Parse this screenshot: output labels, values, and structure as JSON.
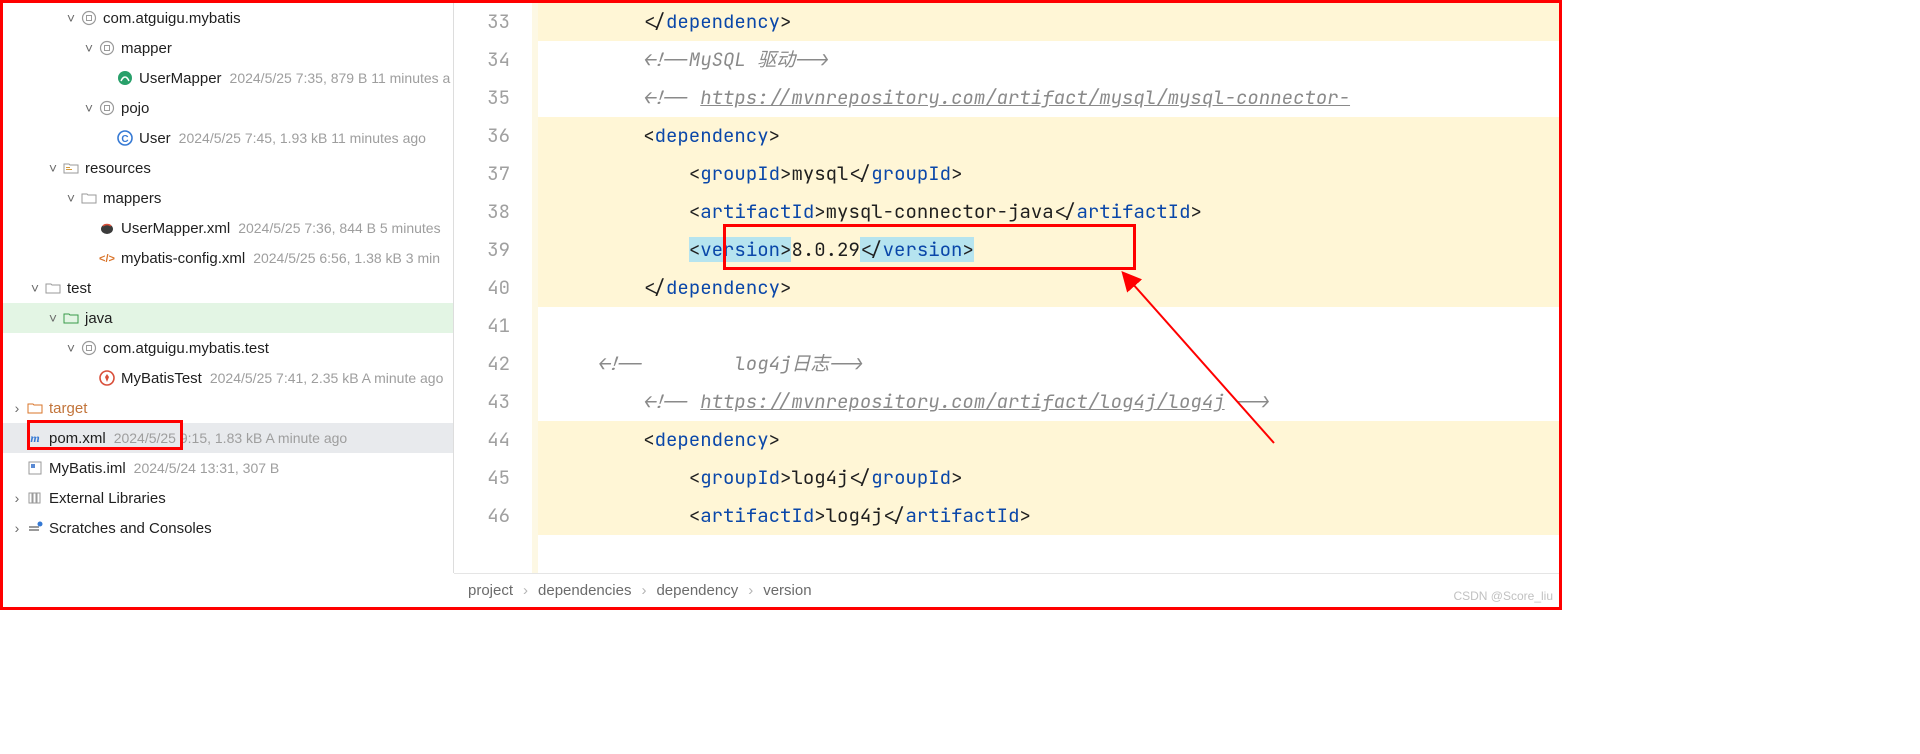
{
  "tree": {
    "n0": {
      "label": "com.atguigu.mybatis"
    },
    "n1": {
      "label": "mapper"
    },
    "n2": {
      "label": "UserMapper",
      "meta": "2024/5/25 7:35, 879 B 11 minutes a"
    },
    "n3": {
      "label": "pojo"
    },
    "n4": {
      "label": "User",
      "meta": "2024/5/25 7:45, 1.93 kB 11 minutes ago"
    },
    "n5": {
      "label": "resources"
    },
    "n6": {
      "label": "mappers"
    },
    "n7": {
      "label": "UserMapper.xml",
      "meta": "2024/5/25 7:36, 844 B 5 minutes"
    },
    "n8": {
      "label": "mybatis-config.xml",
      "meta": "2024/5/25 6:56, 1.38 kB 3 min"
    },
    "n9": {
      "label": "test"
    },
    "n10": {
      "label": "java"
    },
    "n11": {
      "label": "com.atguigu.mybatis.test"
    },
    "n12": {
      "label": "MyBatisTest",
      "meta": "2024/5/25 7:41, 2.35 kB A minute ago"
    },
    "n13": {
      "label": "target"
    },
    "n14": {
      "label": "pom.xml",
      "meta": "2024/5/25 9:15, 1.83 kB A minute ago"
    },
    "n15": {
      "label": "MyBatis.iml",
      "meta": "2024/5/24 13:31, 307 B"
    },
    "n16": {
      "label": "External Libraries"
    },
    "n17": {
      "label": "Scratches and Consoles"
    }
  },
  "lineStart": 33,
  "code": [
    {
      "hl": true,
      "indent": 8,
      "toks": [
        {
          "t": "</",
          "c": "tok-txt"
        },
        {
          "t": "dependency",
          "c": "tok-tag"
        },
        {
          "t": ">",
          "c": "tok-txt"
        }
      ]
    },
    {
      "hl": false,
      "indent": 8,
      "toks": [
        {
          "t": "<!--MySQL 驱动-->",
          "c": "tok-com"
        }
      ]
    },
    {
      "hl": false,
      "indent": 8,
      "toks": [
        {
          "t": "<!-- ",
          "c": "tok-com"
        },
        {
          "t": "https://mvnrepository.com/artifact/mysql/mysql-connector-",
          "c": "tok-comlink"
        }
      ]
    },
    {
      "hl": true,
      "indent": 8,
      "toks": [
        {
          "t": "<",
          "c": "tok-txt"
        },
        {
          "t": "dependency",
          "c": "tok-tag"
        },
        {
          "t": ">",
          "c": "tok-txt"
        }
      ]
    },
    {
      "hl": true,
      "indent": 12,
      "toks": [
        {
          "t": "<",
          "c": "tok-txt"
        },
        {
          "t": "groupId",
          "c": "tok-tag"
        },
        {
          "t": ">",
          "c": "tok-txt"
        },
        {
          "t": "mysql",
          "c": "tok-txt"
        },
        {
          "t": "</",
          "c": "tok-txt"
        },
        {
          "t": "groupId",
          "c": "tok-tag"
        },
        {
          "t": ">",
          "c": "tok-txt"
        }
      ]
    },
    {
      "hl": true,
      "indent": 12,
      "toks": [
        {
          "t": "<",
          "c": "tok-txt"
        },
        {
          "t": "artifactId",
          "c": "tok-tag"
        },
        {
          "t": ">",
          "c": "tok-txt"
        },
        {
          "t": "mysql-connector-java",
          "c": "tok-txt"
        },
        {
          "t": "</",
          "c": "tok-txt"
        },
        {
          "t": "artifactId",
          "c": "tok-tag"
        },
        {
          "t": ">",
          "c": "tok-txt"
        }
      ]
    },
    {
      "hl": true,
      "indent": 12,
      "toks": [
        {
          "t": "<",
          "c": "tok-txt",
          "sel": true
        },
        {
          "t": "version",
          "c": "tok-tag",
          "sel": true
        },
        {
          "t": ">",
          "c": "tok-txt",
          "sel": true
        },
        {
          "t": "8.0.29",
          "c": "tok-txt"
        },
        {
          "t": "</",
          "c": "tok-txt",
          "sel": true
        },
        {
          "t": "version",
          "c": "tok-tag",
          "sel": true
        },
        {
          "t": ">",
          "c": "tok-txt",
          "sel": true
        }
      ]
    },
    {
      "hl": true,
      "indent": 8,
      "toks": [
        {
          "t": "</",
          "c": "tok-txt"
        },
        {
          "t": "dependency",
          "c": "tok-tag"
        },
        {
          "t": ">",
          "c": "tok-txt"
        }
      ]
    },
    {
      "hl": false,
      "indent": 0,
      "toks": []
    },
    {
      "hl": false,
      "indent": 4,
      "toks": [
        {
          "t": "<!--        log4j日志-->",
          "c": "tok-com"
        }
      ]
    },
    {
      "hl": false,
      "indent": 8,
      "toks": [
        {
          "t": "<!-- ",
          "c": "tok-com"
        },
        {
          "t": "https://mvnrepository.com/artifact/log4j/log4j",
          "c": "tok-comlink"
        },
        {
          "t": " -->",
          "c": "tok-com"
        }
      ]
    },
    {
      "hl": true,
      "indent": 8,
      "toks": [
        {
          "t": "<",
          "c": "tok-txt"
        },
        {
          "t": "dependency",
          "c": "tok-tag"
        },
        {
          "t": ">",
          "c": "tok-txt"
        }
      ]
    },
    {
      "hl": true,
      "indent": 12,
      "toks": [
        {
          "t": "<",
          "c": "tok-txt"
        },
        {
          "t": "groupId",
          "c": "tok-tag"
        },
        {
          "t": ">",
          "c": "tok-txt"
        },
        {
          "t": "log4j",
          "c": "tok-txt"
        },
        {
          "t": "</",
          "c": "tok-txt"
        },
        {
          "t": "groupId",
          "c": "tok-tag"
        },
        {
          "t": ">",
          "c": "tok-txt"
        }
      ]
    },
    {
      "hl": true,
      "indent": 12,
      "toks": [
        {
          "t": "<",
          "c": "tok-txt"
        },
        {
          "t": "artifactId",
          "c": "tok-tag"
        },
        {
          "t": ">",
          "c": "tok-txt"
        },
        {
          "t": "log4j",
          "c": "tok-txt"
        },
        {
          "t": "</",
          "c": "tok-txt"
        },
        {
          "t": "artifactId",
          "c": "tok-tag"
        },
        {
          "t": ">",
          "c": "tok-txt"
        }
      ]
    }
  ],
  "crumbs": [
    "project",
    "dependencies",
    "dependency",
    "version"
  ],
  "watermark": "CSDN @Score_liu"
}
